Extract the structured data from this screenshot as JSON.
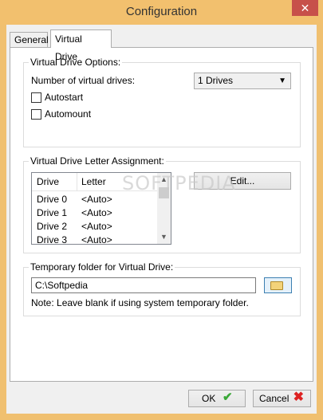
{
  "window": {
    "title": "Configuration",
    "close_symbol": "✕"
  },
  "tabs": [
    {
      "label": "General"
    },
    {
      "label": "Virtual Drive"
    }
  ],
  "options": {
    "group_label": "Virtual Drive Options:",
    "num_drives_label": "Number of virtual drives:",
    "num_drives_value": "1 Drives",
    "autostart_label": "Autostart",
    "autostart_checked": false,
    "automount_label": "Automount",
    "automount_checked": false
  },
  "letters": {
    "group_label": "Virtual Drive Letter Assignment:",
    "columns": [
      "Drive",
      "Letter"
    ],
    "rows": [
      {
        "drive": "Drive 0",
        "letter": "<Auto>"
      },
      {
        "drive": "Drive 1",
        "letter": "<Auto>"
      },
      {
        "drive": "Drive 2",
        "letter": "<Auto>"
      },
      {
        "drive": "Drive 3",
        "letter": "<Auto>"
      }
    ],
    "edit_label": "Edit..."
  },
  "temp": {
    "group_label": "Temporary folder for Virtual Drive:",
    "path_value": "C:\\Softpedia",
    "note": "Note: Leave blank if using system temporary folder."
  },
  "watermark": "SOFTPEDIA",
  "footer": {
    "ok_label": "OK",
    "cancel_label": "Cancel"
  }
}
